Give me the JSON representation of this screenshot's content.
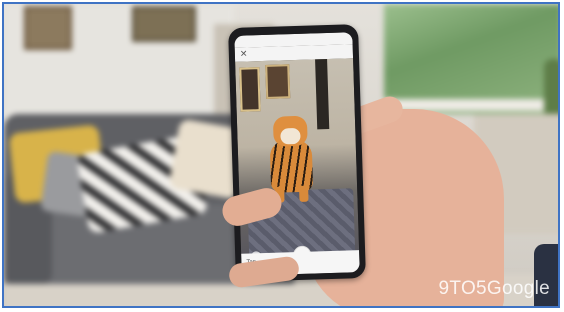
{
  "photo": {
    "subject": "",
    "watermark": "9TO5Google"
  },
  "phone_screen": {
    "status_time": "",
    "status_icons": "",
    "sheet_label": "Tap"
  },
  "colors": {
    "border": "#3f73c4",
    "tiger_orange": "#df8f3f",
    "sofa": "#5f6064"
  }
}
